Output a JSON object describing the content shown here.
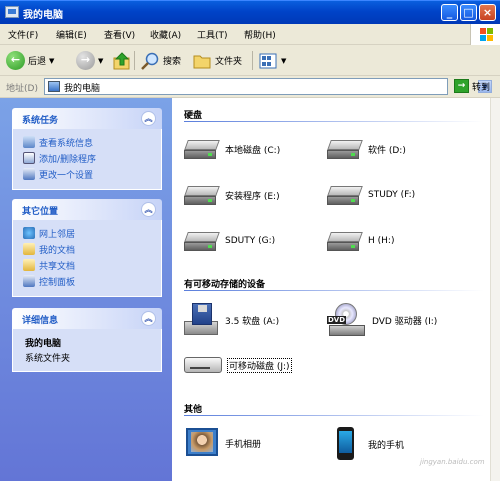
{
  "window": {
    "title": "我的电脑"
  },
  "menu": [
    "文件(F)",
    "编辑(E)",
    "查看(V)",
    "收藏(A)",
    "工具(T)",
    "帮助(H)"
  ],
  "toolbar": {
    "back": "后退",
    "search": "搜索",
    "folders": "文件夹"
  },
  "address": {
    "label": "地址(D)",
    "value": "我的电脑",
    "go": "转到"
  },
  "sidebar": {
    "tasks": {
      "title": "系统任务",
      "items": [
        "查看系统信息",
        "添加/删除程序",
        "更改一个设置"
      ]
    },
    "places": {
      "title": "其它位置",
      "items": [
        "网上邻居",
        "我的文档",
        "共享文档",
        "控制面板"
      ]
    },
    "details": {
      "title": "详细信息",
      "name": "我的电脑",
      "type": "系统文件夹"
    }
  },
  "groups": {
    "hard_disks": {
      "title": "硬盘",
      "items": [
        "本地磁盘 (C:)",
        "软件 (D:)",
        "安装程序 (E:)",
        "STUDY (F:)",
        "SDUTY (G:)",
        "H (H:)"
      ]
    },
    "removable": {
      "title": "有可移动存储的设备",
      "items": [
        "3.5 软盘 (A:)",
        "DVD 驱动器 (I:)",
        "可移动磁盘 (J:)"
      ]
    },
    "other": {
      "title": "其他",
      "items": [
        "手机相册",
        "我的手机"
      ]
    }
  },
  "watermark": "jingyan.baidu.com"
}
